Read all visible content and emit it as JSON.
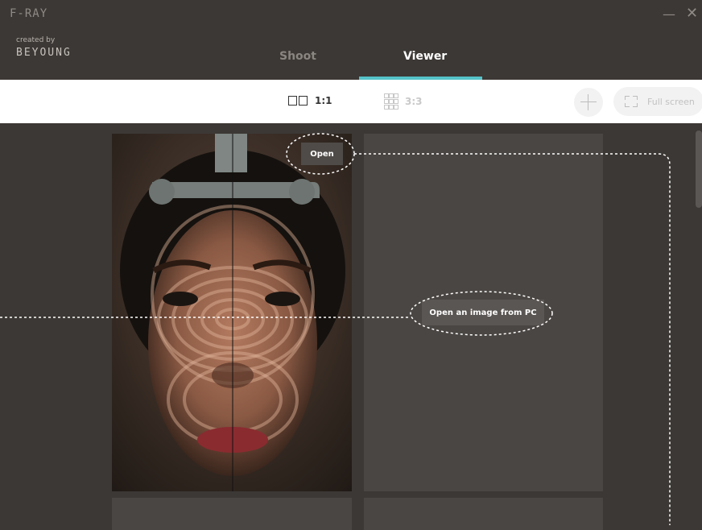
{
  "window": {
    "title": "F-RAY",
    "minimize_glyph": "—",
    "close_glyph": "✕"
  },
  "branding": {
    "created_by": "created by",
    "logo": "BEYOUNG"
  },
  "tabs": [
    {
      "label": "Shoot",
      "active": false
    },
    {
      "label": "Viewer",
      "active": true
    }
  ],
  "toolbar": {
    "layout_1x1_label": "1:1",
    "layout_3x3_label": "3:3",
    "fullscreen_label": "Full screen"
  },
  "viewer": {
    "open_button": "Open",
    "open_pc_button": "Open an image from PC"
  },
  "colors": {
    "accent": "#55c3c8",
    "background": "#3c3835",
    "panel": "#4a4643"
  },
  "icons": [
    "minimize-icon",
    "close-icon",
    "layout-1x1-icon",
    "layout-3x3-icon",
    "crosshair-icon",
    "fullscreen-icon"
  ]
}
